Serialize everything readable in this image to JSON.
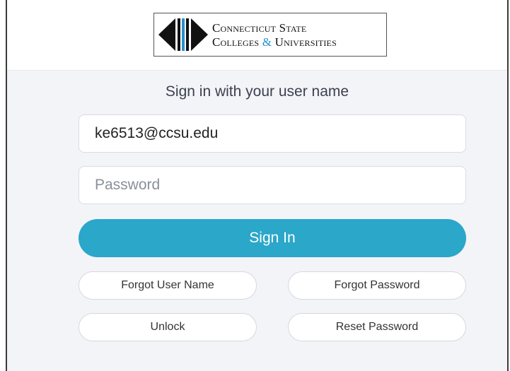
{
  "logo": {
    "line1": "Connecticut State",
    "line2_start": "Colleges ",
    "line2_amp": "&",
    "line2_end": " Universities"
  },
  "form": {
    "title": "Sign in with your user name",
    "username_value": "ke6513@ccsu.edu",
    "password_placeholder": "Password",
    "signin_label": "Sign In"
  },
  "links": {
    "forgot_user": "Forgot User Name",
    "forgot_password": "Forgot Password",
    "unlock": "Unlock",
    "reset_password": "Reset Password"
  },
  "colors": {
    "primary": "#2aa7c9",
    "logo_accent": "#2a8fd0",
    "background": "#f3f4f8"
  }
}
